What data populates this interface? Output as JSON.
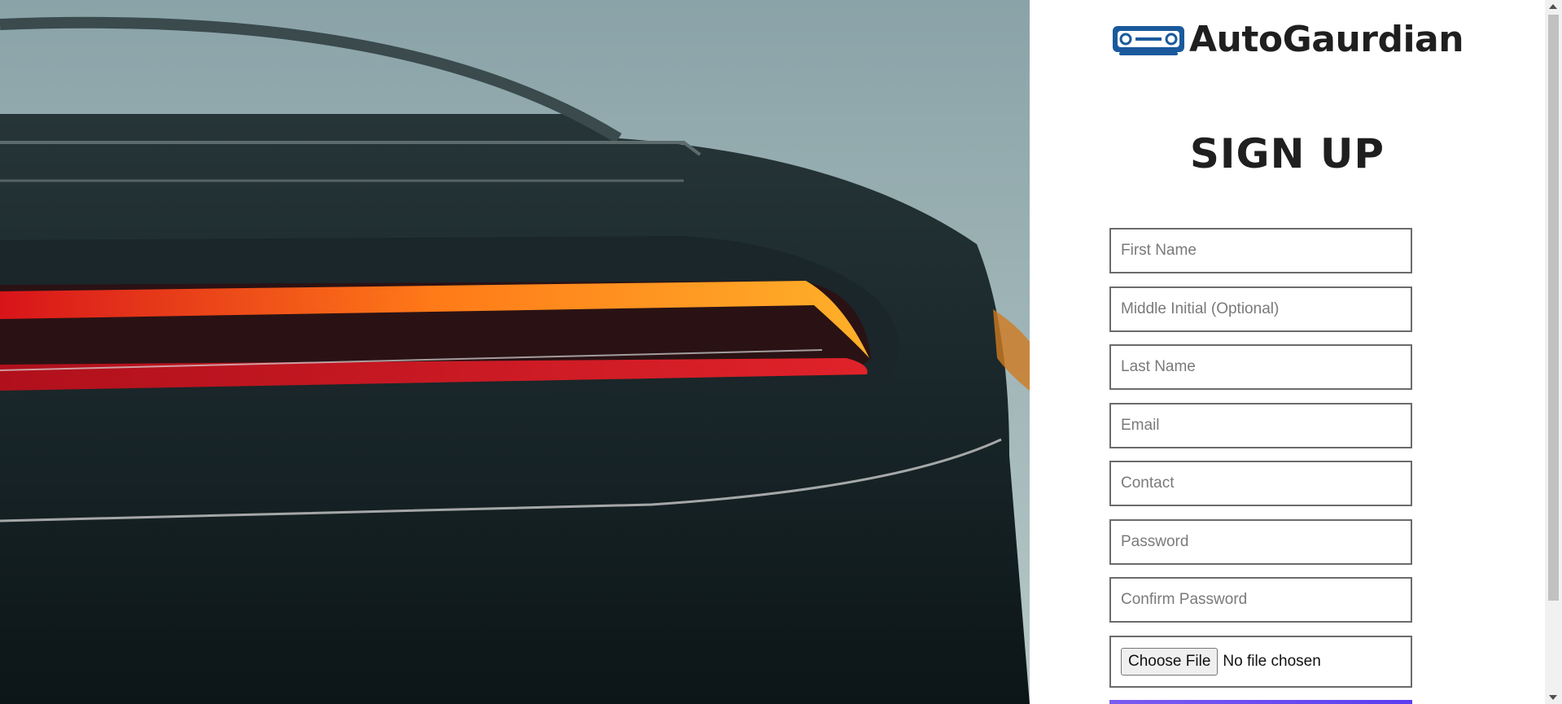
{
  "brand": {
    "logo_text": "AutoGaurdian",
    "logo_icon": "car-front-icon",
    "accent_color": "#1a5a9c"
  },
  "hero": {
    "image": "car-taillight-photo"
  },
  "form": {
    "title": "SIGN UP",
    "fields": {
      "first_name": "First Name",
      "middle_initial": "Middle Initial (Optional)",
      "last_name": "Last Name",
      "email": "Email",
      "contact": "Contact",
      "password": "Password",
      "confirm_password": "Confirm Password"
    },
    "file": {
      "button_label": "Choose File",
      "status": "No file chosen"
    },
    "submit_color": "#6b4ef0"
  }
}
